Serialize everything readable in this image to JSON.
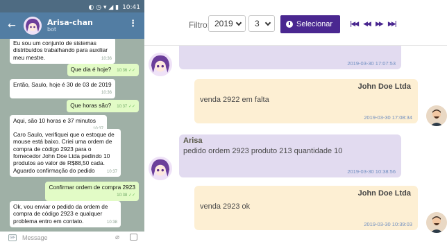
{
  "phone": {
    "status_time": "10:41",
    "chat_title": "Arisa-chan",
    "chat_subtitle": "bot",
    "input_placeholder": "Message",
    "messages": [
      {
        "dir": "in",
        "text": "Eu sou um conjunto de sistemas distribuídos trabalhando para auxiliar meu mestre.",
        "time": "10:36"
      },
      {
        "dir": "out",
        "text": "Que dia é hoje?",
        "time": "10:36"
      },
      {
        "dir": "in",
        "text": "Então, Saulo, hoje é 30 de 03 de 2019",
        "time": "10:36"
      },
      {
        "dir": "out",
        "text": "Que horas são?",
        "time": "10:37"
      },
      {
        "dir": "in",
        "text": "Aqui, são 10 horas e 37 minutos",
        "time": "10:37"
      },
      {
        "dir": "in",
        "text": "Caro Saulo, verifiquei que o estoque de mouse está baixo. Criei uma ordem de compra de código 2923 para o fornecedor John Doe Ltda pedindo 10 produtos ao valor de R$88,50 cada. Aguardo confirmação do pedido",
        "time": "10:37"
      },
      {
        "dir": "out",
        "text": "Confirmar ordem de compra 2923",
        "time": "10:38"
      },
      {
        "dir": "in",
        "text": "Ok, vou enviar o pedido da ordem de compra de código 2923 e qualquer problema entro em contato.",
        "time": "10:38"
      }
    ]
  },
  "web": {
    "filter_label": "Filtro:",
    "year_value": "2019",
    "num_value": "3",
    "select_button": "Selecionar",
    "nav_first": "⏮",
    "nav_prev": "⏪",
    "nav_next": "⏩",
    "nav_last": "⏭",
    "messages": [
      {
        "kind": "bot",
        "author": "",
        "text": "",
        "timestamp": "2019-03-30 17:07:53"
      },
      {
        "kind": "user",
        "author": "John Doe Ltda",
        "text": "venda 2922 em falta",
        "timestamp": "2019-03-30 17:08:34"
      },
      {
        "kind": "bot",
        "author": "Arisa",
        "text": "pedido ordem 2923 produto 213 quantidade 10",
        "timestamp": "2019-03-30 10:38:56"
      },
      {
        "kind": "user",
        "author": "John Doe Ltda",
        "text": "venda 2923 ok",
        "timestamp": "2019-03-30 10:39:03"
      }
    ]
  }
}
